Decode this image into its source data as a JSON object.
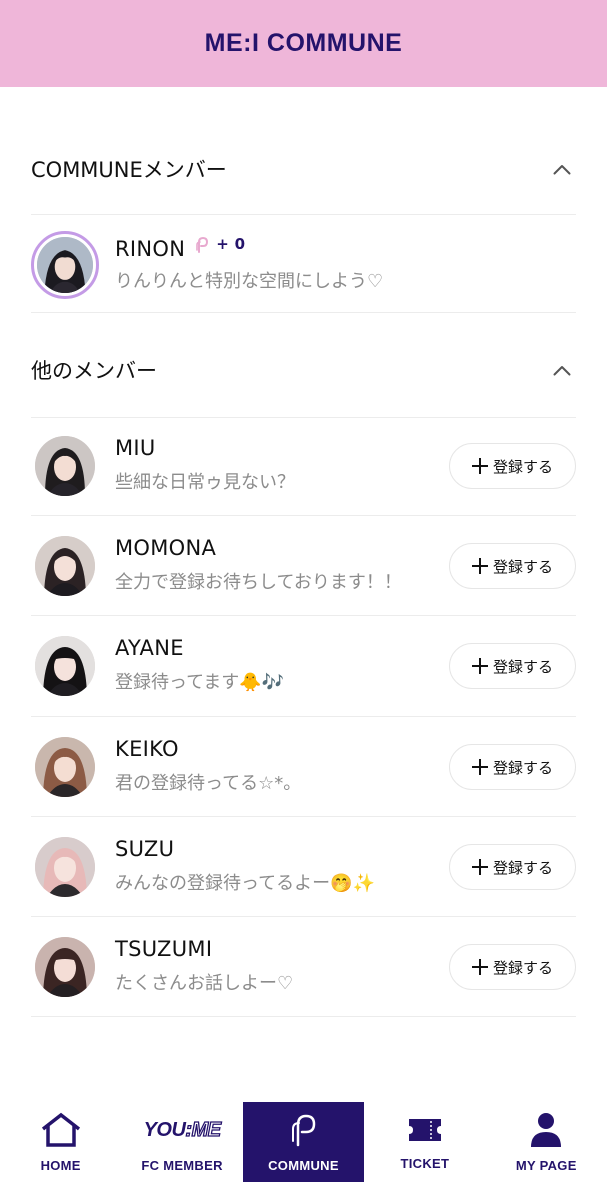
{
  "header": {
    "title": "ME:I COMMUNE"
  },
  "sections": {
    "commune": {
      "title": "COMMUNEメンバー",
      "toggle_icon": "chevron-up-icon"
    },
    "others": {
      "title": "他のメンバー",
      "toggle_icon": "chevron-up-icon"
    }
  },
  "commune_member": {
    "name": "RINON",
    "points": "+ 0",
    "message": "りんりんと特別な空間にしよう♡"
  },
  "register_label": "登録する",
  "members": [
    {
      "name": "MIU",
      "message": "些細な日常ゥ見ない？"
    },
    {
      "name": "MOMONA",
      "message": "全力で登録お待ちしております！！"
    },
    {
      "name": "AYANE",
      "message": "登録待ってます🐥🎶"
    },
    {
      "name": "KEIKO",
      "message": "君の登録待ってる☆*。"
    },
    {
      "name": "SUZU",
      "message": "みんなの登録待ってるよー🤭✨"
    },
    {
      "name": "TSUZUMI",
      "message": "たくさんお話しよー♡"
    }
  ],
  "nav": {
    "items": [
      {
        "label": "HOME",
        "icon": "home-icon"
      },
      {
        "label": "FC MEMBER",
        "icon": "youme-logo",
        "logo_text_a": "YOU",
        "logo_text_b": ":ME"
      },
      {
        "label": "COMMUNE",
        "icon": "commune-icon",
        "active": true
      },
      {
        "label": "TICKET",
        "icon": "ticket-icon"
      },
      {
        "label": "MY PAGE",
        "icon": "user-icon"
      }
    ]
  },
  "colors": {
    "header_bg": "#efb6d9",
    "brand": "#24136b",
    "avatar_ring": "#c49be6",
    "muted_text": "#8c8c8c"
  }
}
